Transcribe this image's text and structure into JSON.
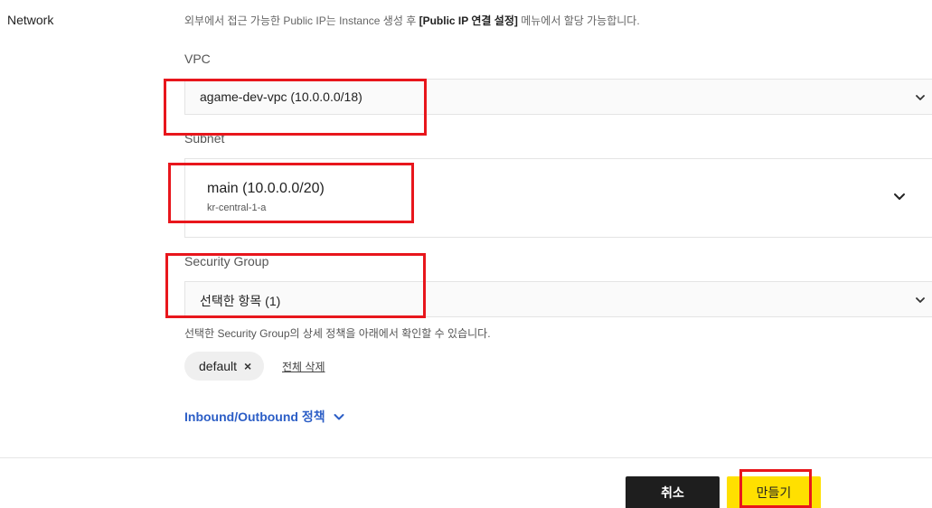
{
  "network": {
    "section_label": "Network",
    "info_prefix": "외부에서 접근 가능한 Public IP는 Instance 생성 후 ",
    "info_bold": "[Public IP 연결 설정]",
    "info_suffix": " 메뉴에서 할당 가능합니다."
  },
  "vpc": {
    "label": "VPC",
    "selected": "agame-dev-vpc (10.0.0.0/18)",
    "icon": "chevron-down-icon"
  },
  "subnet": {
    "label": "Subnet",
    "name": "main (10.0.0.0/20)",
    "zone": "kr-central-1-a",
    "icon": "chevron-down-icon"
  },
  "security_group": {
    "label": "Security Group",
    "selected": "선택한 항목 (1)",
    "hint": "선택한 Security Group의 상세 정책을 아래에서 확인할 수 있습니다.",
    "chips": [
      "default"
    ],
    "chip_remove": "×",
    "clear_all": "전체 삭제",
    "icon": "chevron-down-icon"
  },
  "policy": {
    "link_label": "Inbound/Outbound 정책",
    "icon": "chevron-down-icon",
    "color": "#2c5ec6"
  },
  "footer": {
    "cancel_label": "취소",
    "create_label": "만들기",
    "create_color": "#ffe000",
    "cancel_color": "#1e1e1e"
  },
  "annotation_color": "#e8161c"
}
